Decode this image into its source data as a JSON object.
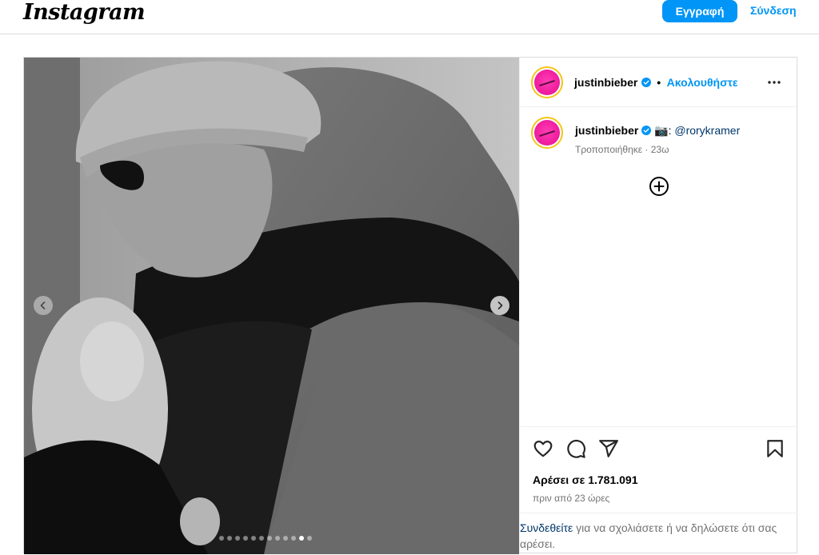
{
  "header": {
    "logo_text": "Instagram",
    "signup_label": "Εγγραφή",
    "login_label": "Σύνδεση"
  },
  "post": {
    "username": "justinbieber",
    "follow_separator": "•",
    "follow_label": "Ακολουθήστε",
    "caption_camera": "📷",
    "caption_sep": ":",
    "caption_mention": "@rorykramer",
    "edited_text": "Τροποποιήθηκε · 23ω",
    "likes_text": "Αρέσει σε 1.781.091",
    "time_text": "πριν από 23 ώρες",
    "login_prompt_link": "Συνδεθείτε",
    "login_prompt_rest": " για να σχολιάσετε ή να δηλώσετε ότι σας αρέσει."
  },
  "carousel": {
    "slide_count": 12,
    "active_index": 10
  },
  "icons": [
    "chevron-left-icon",
    "chevron-right-icon",
    "verified-badge-icon",
    "more-icon",
    "add-circle-icon",
    "heart-icon",
    "comment-icon",
    "share-icon",
    "bookmark-icon"
  ],
  "colors": {
    "accent": "#0095f6",
    "link_dark": "#00376b",
    "muted": "#737373",
    "border": "#dbdbdb"
  }
}
